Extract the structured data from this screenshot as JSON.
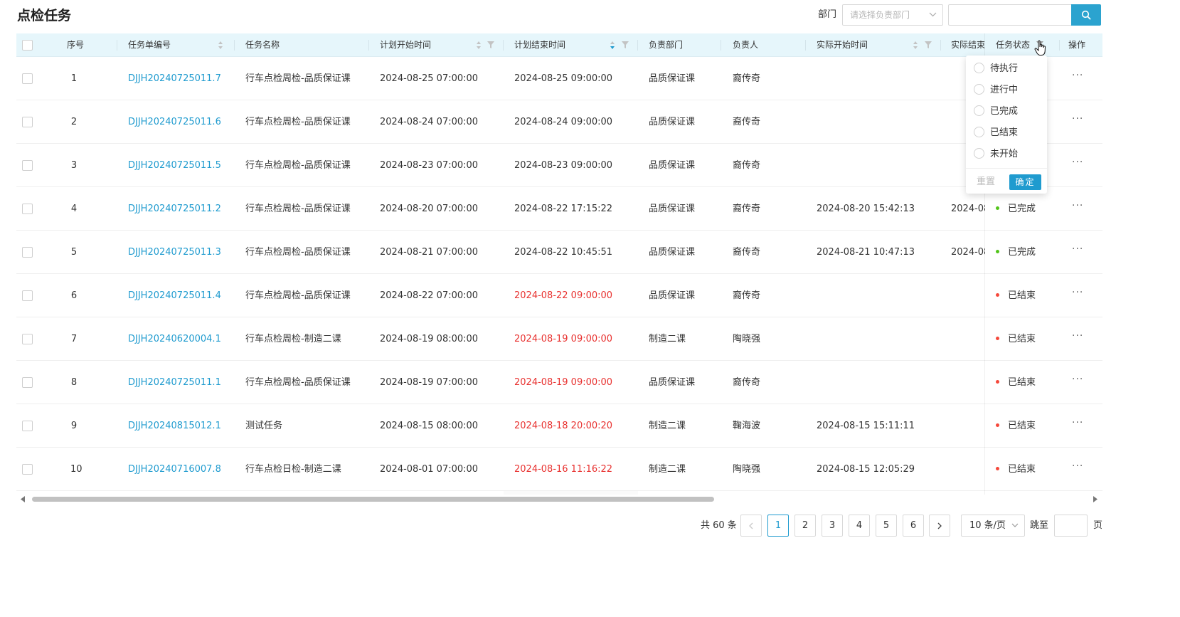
{
  "page": {
    "title": "点检任务"
  },
  "filters": {
    "dept_label": "部门",
    "dept_placeholder": "请选择负责部门",
    "search_value": ""
  },
  "table": {
    "columns": {
      "index": "序号",
      "task_no": "任务单编号",
      "task_name": "任务名称",
      "plan_start": "计划开始时间",
      "plan_end": "计划结束时间",
      "dept": "负责部门",
      "owner": "负责人",
      "actual_start": "实际开始时间",
      "actual_end": "实际结束",
      "status": "任务状态",
      "action": "操作"
    },
    "rows": [
      {
        "idx": "1",
        "no": "DJJH20240725011.7",
        "name": "行车点检周检-品质保证课",
        "ps": "2024-08-25 07:00:00",
        "pe": "2024-08-25 09:00:00",
        "pe_overdue": false,
        "dept": "品质保证课",
        "owner": "裔传奇",
        "as": "",
        "ae": "",
        "status": "",
        "status_color": ""
      },
      {
        "idx": "2",
        "no": "DJJH20240725011.6",
        "name": "行车点检周检-品质保证课",
        "ps": "2024-08-24 07:00:00",
        "pe": "2024-08-24 09:00:00",
        "pe_overdue": false,
        "dept": "品质保证课",
        "owner": "裔传奇",
        "as": "",
        "ae": "",
        "status": "",
        "status_color": ""
      },
      {
        "idx": "3",
        "no": "DJJH20240725011.5",
        "name": "行车点检周检-品质保证课",
        "ps": "2024-08-23 07:00:00",
        "pe": "2024-08-23 09:00:00",
        "pe_overdue": false,
        "dept": "品质保证课",
        "owner": "裔传奇",
        "as": "",
        "ae": "",
        "status": "",
        "status_color": ""
      },
      {
        "idx": "4",
        "no": "DJJH20240725011.2",
        "name": "行车点检周检-品质保证课",
        "ps": "2024-08-20 07:00:00",
        "pe": "2024-08-22 17:15:22",
        "pe_overdue": false,
        "dept": "品质保证课",
        "owner": "裔传奇",
        "as": "2024-08-20 15:42:13",
        "ae": "2024-08",
        "status": "已完成",
        "status_color": "#52c41a"
      },
      {
        "idx": "5",
        "no": "DJJH20240725011.3",
        "name": "行车点检周检-品质保证课",
        "ps": "2024-08-21 07:00:00",
        "pe": "2024-08-22 10:45:51",
        "pe_overdue": false,
        "dept": "品质保证课",
        "owner": "裔传奇",
        "as": "2024-08-21 10:47:13",
        "ae": "2024-08",
        "status": "已完成",
        "status_color": "#52c41a"
      },
      {
        "idx": "6",
        "no": "DJJH20240725011.4",
        "name": "行车点检周检-品质保证课",
        "ps": "2024-08-22 07:00:00",
        "pe": "2024-08-22 09:00:00",
        "pe_overdue": true,
        "dept": "品质保证课",
        "owner": "裔传奇",
        "as": "",
        "ae": "",
        "status": "已结束",
        "status_color": "#f5483b"
      },
      {
        "idx": "7",
        "no": "DJJH20240620004.1",
        "name": "行车点检周检-制造二课",
        "ps": "2024-08-19 08:00:00",
        "pe": "2024-08-19 09:00:00",
        "pe_overdue": true,
        "dept": "制造二课",
        "owner": "陶晓强",
        "as": "",
        "ae": "",
        "status": "已结束",
        "status_color": "#f5483b"
      },
      {
        "idx": "8",
        "no": "DJJH20240725011.1",
        "name": "行车点检周检-品质保证课",
        "ps": "2024-08-19 07:00:00",
        "pe": "2024-08-19 09:00:00",
        "pe_overdue": true,
        "dept": "品质保证课",
        "owner": "裔传奇",
        "as": "",
        "ae": "",
        "status": "已结束",
        "status_color": "#f5483b"
      },
      {
        "idx": "9",
        "no": "DJJH20240815012.1",
        "name": "测试任务",
        "ps": "2024-08-15 08:00:00",
        "pe": "2024-08-18 20:00:20",
        "pe_overdue": true,
        "dept": "制造二课",
        "owner": "鞠海波",
        "as": "2024-08-15 15:11:11",
        "ae": "",
        "status": "已结束",
        "status_color": "#f5483b"
      },
      {
        "idx": "10",
        "no": "DJJH20240716007.8",
        "name": "行车点检日检-制造二课",
        "ps": "2024-08-01 07:00:00",
        "pe": "2024-08-16 11:16:22",
        "pe_overdue": true,
        "dept": "制造二课",
        "owner": "陶晓强",
        "as": "2024-08-15 12:05:29",
        "ae": "",
        "status": "已结束",
        "status_color": "#f5483b"
      }
    ],
    "more_glyph": "···"
  },
  "status_filter": {
    "options": [
      "待执行",
      "进行中",
      "已完成",
      "已结束",
      "未开始"
    ],
    "reset_label": "重置",
    "ok_label": "确定"
  },
  "pagination": {
    "total_label": "共 60 条",
    "pages": [
      "1",
      "2",
      "3",
      "4",
      "5",
      "6"
    ],
    "current": "1",
    "prev": "<",
    "next": ">",
    "page_size": "10 条/页",
    "jump_label": "跳至",
    "page_suffix": "页"
  },
  "colors": {
    "accent": "#1f9bcf",
    "header_bg": "#e6f6fb",
    "overdue": "#e8312f",
    "done": "#52c41a",
    "ended": "#f5483b"
  }
}
